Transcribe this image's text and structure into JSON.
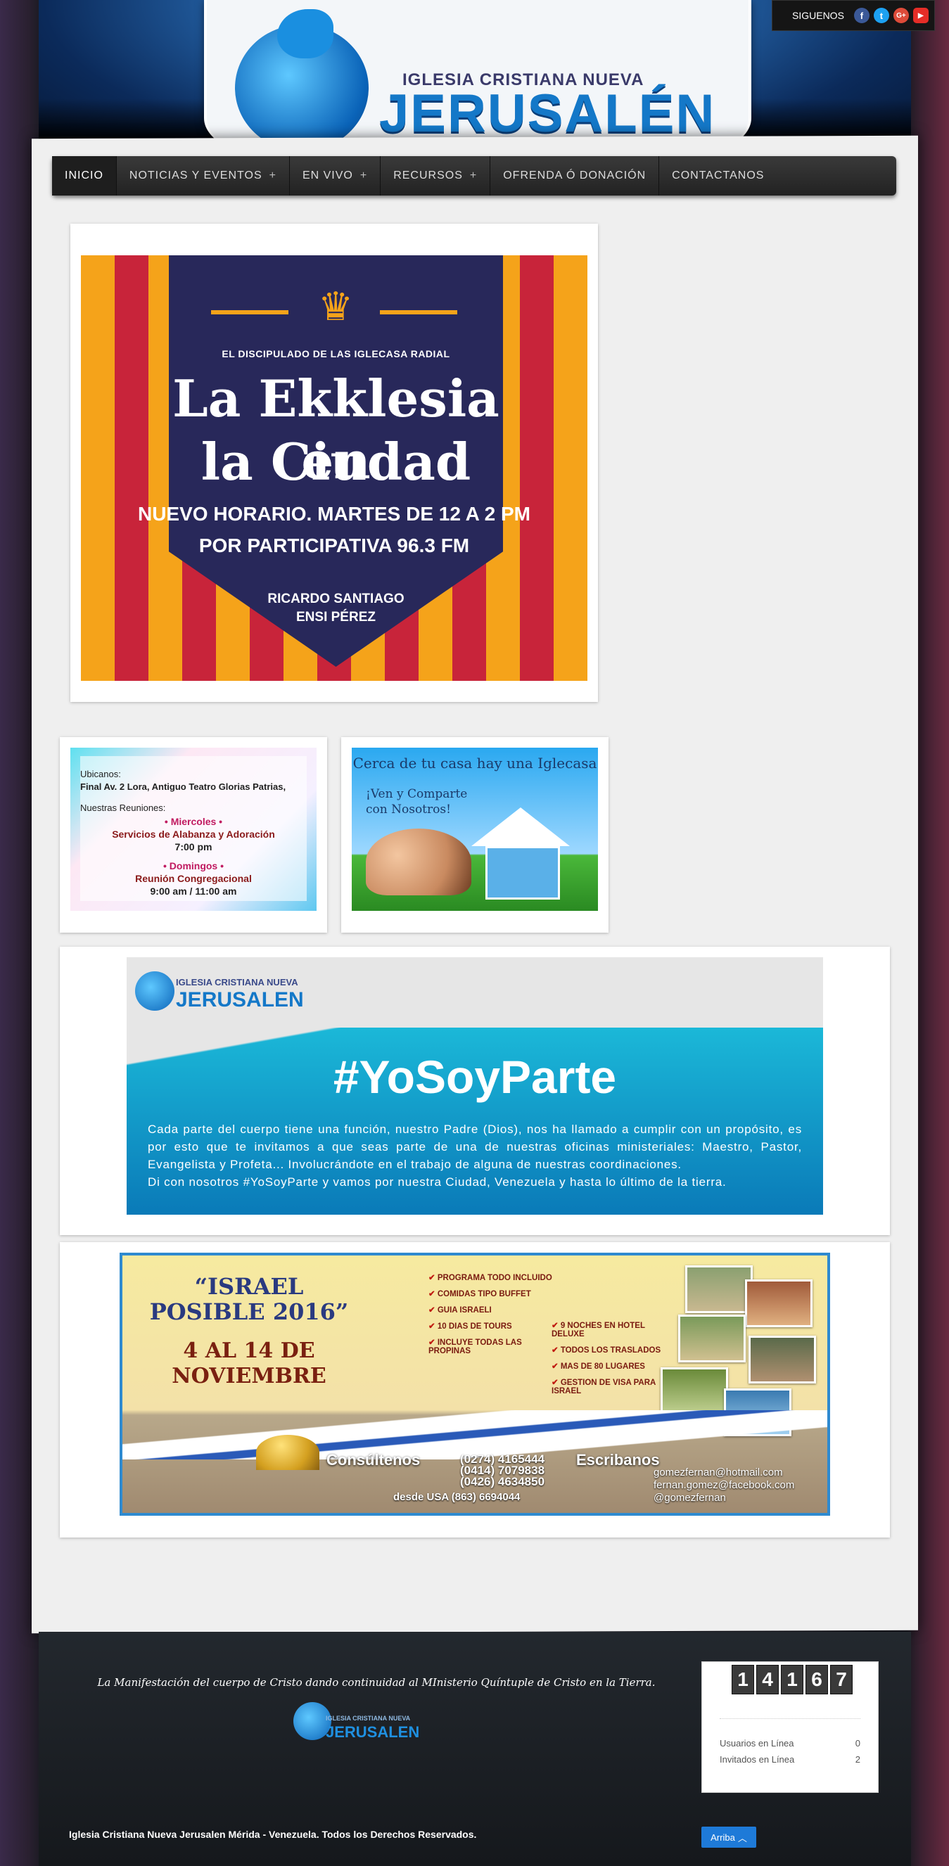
{
  "header": {
    "logo_small": "IGLESIA CRISTIANA NUEVA",
    "logo_big": "JERUSALÉN",
    "social_label": "SIGUENOS",
    "social_icons": [
      "facebook-icon",
      "twitter-icon",
      "google-plus-icon",
      "youtube-icon"
    ],
    "social_glyphs": {
      "facebook": "f",
      "twitter": "t",
      "google": "G+",
      "youtube": "▶"
    },
    "colors": {
      "facebook": "#3b5998",
      "twitter": "#1da1f2",
      "google": "#dd4b39",
      "youtube": "#e52d27"
    }
  },
  "nav": {
    "items": [
      {
        "label": "INICIO",
        "active": true,
        "has_sub": false
      },
      {
        "label": "NOTICIAS Y EVENTOS",
        "active": false,
        "has_sub": true
      },
      {
        "label": "EN VIVO",
        "active": false,
        "has_sub": true
      },
      {
        "label": "RECURSOS",
        "active": false,
        "has_sub": true
      },
      {
        "label": "OFRENDA Ó DONACIÓN",
        "active": false,
        "has_sub": false
      },
      {
        "label": "CONTACTANOS",
        "active": false,
        "has_sub": false
      }
    ],
    "plus": "+"
  },
  "banner_radio": {
    "kicker": "EL DISCIPULADO DE LAS IGLECASA RADIAL",
    "title_line1": "La Ekklesia en",
    "title_line2": "la Ciudad",
    "schedule": "NUEVO HORARIO. MARTES DE 12 A 2 PM",
    "station": "POR PARTICIPATIVA 96.3 FM",
    "host1": "RICARDO SANTIAGO",
    "host2": "ENSI PÉREZ"
  },
  "banner_location": {
    "ubicanos": "Ubicanos:",
    "address": "Final Av. 2 Lora, Antiguo Teatro Glorias Patrias,",
    "reuniones": "Nuestras Reuniones:",
    "day1": "• Miercoles •",
    "service1": "Servicios de Alabanza y Adoración",
    "time1": "7:00 pm",
    "day2": "• Domingos •",
    "service2": "Reunión Congregacional",
    "time2": "9:00 am / 11:00 am"
  },
  "banner_iglecasa": {
    "head": "Cerca de tu casa hay una Iglecasa",
    "sub1": "¡Ven y Comparte",
    "sub2": "con Nosotros!"
  },
  "banner_yosoyparte": {
    "logo_small": "IGLESIA CRISTIANA NUEVA",
    "logo_big": "JERUSALEN",
    "hashtag": "#YoSoyParte",
    "paragraph1": "Cada parte del cuerpo tiene una función, nuestro Padre (Dios), nos ha llamado a cumplir con un propósito, es por esto que te invitamos a que seas parte de una de nuestras oficinas ministeriales: Maestro, Pastor, Evangelista y Profeta... Involucrándote en el trabajo de alguna de nuestras coordinaciones.",
    "paragraph2": "Di con nosotros #YoSoyParte y vamos por nuestra Ciudad, Venezuela y hasta lo último de la tierra."
  },
  "banner_israel": {
    "title1": "“ISRAEL",
    "title2": "POSIBLE 2016”",
    "dates1": "4 AL 14 DE",
    "dates2": "NOVIEMBRE",
    "list1": [
      "PROGRAMA TODO INCLUIDO",
      "COMIDAS TIPO BUFFET",
      "GUIA ISRAELI",
      "10 DIAS DE TOURS",
      "INCLUYE TODAS LAS PROPINAS"
    ],
    "list2": [
      "9 NOCHES EN HOTEL DELUXE",
      "TODOS LOS TRASLADOS",
      "MAS DE 80 LUGARES",
      "GESTION DE VISA PARA ISRAEL"
    ],
    "consultenos": "Consúltenos",
    "escribanos": "Escribanos",
    "phone1": "(0274) 4165444",
    "phone2": "(0414) 7079838",
    "phone3": "(0426) 4634850",
    "usa": "desde USA (863) 6694044",
    "email": "gomezfernan@hotmail.com",
    "facebook": "fernan.gomez@facebook.com",
    "twitter": "@gomezfernan"
  },
  "footer": {
    "motto": "La Manifestación del cuerpo de Cristo dando continuidad al MInisterio Quíntuple de Cristo en la Tierra.",
    "logo_small": "IGLESIA CRISTIANA NUEVA",
    "logo_big": "JERUSALEN",
    "copyright": "Iglesia Cristiana Nueva Jerusalen Mérida - Venezuela. Todos los Derechos Reservados.",
    "counter_digits": [
      "1",
      "4",
      "1",
      "6",
      "7"
    ],
    "online_users_label": "Usuarios en Línea",
    "online_users_value": "0",
    "guests_label": "Invitados en Línea",
    "guests_value": "2",
    "top_button": "Arriba",
    "top_icon": "chevron-up-icon"
  }
}
